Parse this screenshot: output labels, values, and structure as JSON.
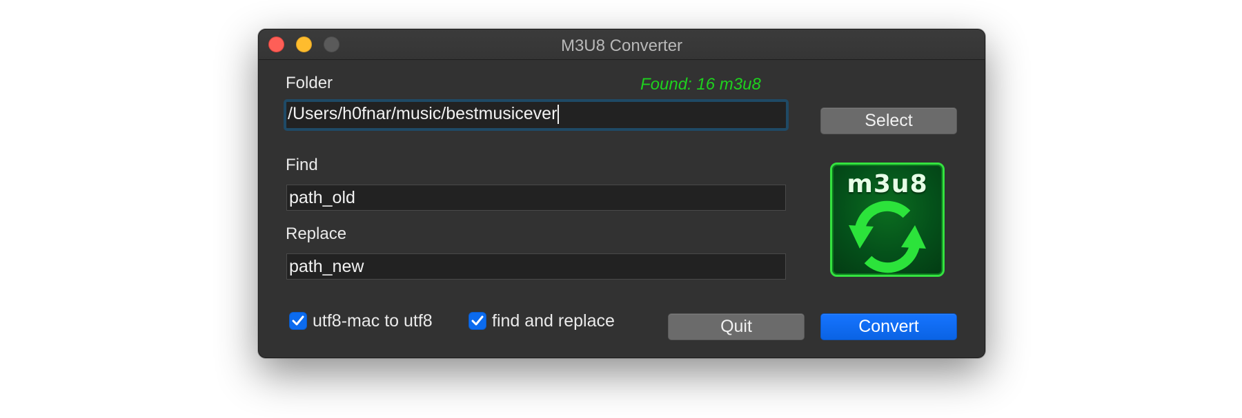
{
  "window": {
    "title": "M3U8 Converter"
  },
  "folder": {
    "label": "Folder",
    "value": "/Users/h0fnar/music/bestmusicever",
    "found_text": "Found: 16 m3u8",
    "select_label": "Select"
  },
  "find": {
    "label": "Find",
    "value": "path_old"
  },
  "replace": {
    "label": "Replace",
    "value": "path_new"
  },
  "options": {
    "utf8_label": "utf8-mac to utf8",
    "utf8_checked": true,
    "find_replace_label": "find and replace",
    "find_replace_checked": true
  },
  "actions": {
    "quit_label": "Quit",
    "convert_label": "Convert"
  },
  "logo": {
    "text": "m3u8",
    "icon": "refresh-arrows-icon"
  },
  "colors": {
    "found": "#1ed11e",
    "primary": "#0b6bef",
    "window_bg": "#323232",
    "logo_border": "#34e23f",
    "logo_arrow": "#2ce33b"
  }
}
